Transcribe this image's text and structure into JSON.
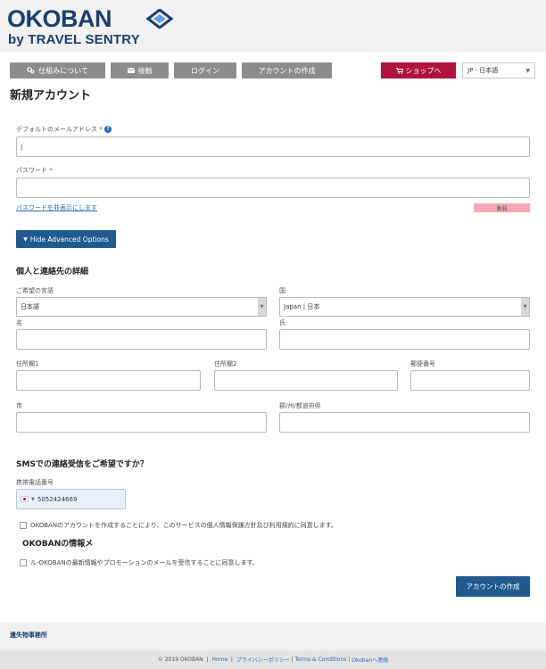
{
  "brand": {
    "logo_text": "OKOBAN",
    "logo_sub": "by TRAVEL SENTRY"
  },
  "nav": {
    "how_it_works": "仕組みについて",
    "contact": "接触",
    "login": "ログイン",
    "create_account": "アカウントの作成",
    "shop": "ショップへ",
    "language": "JP - 日本語"
  },
  "page": {
    "title": "新規アカウント"
  },
  "form": {
    "email_label": "デフォルトのメールアドレス *",
    "email_value": "|",
    "password_label": "パスワード *",
    "password_value": "",
    "hide_password_link": "パスワードを非表示にします",
    "strength_label": "脆弱",
    "advanced_button": "Hide Advanced Options",
    "personal_section_title": "個人と連絡先の詳細",
    "preferred_language_label": "ご希望の言語",
    "preferred_language_value": "日本語",
    "country_label": "国",
    "country_value": "Japan | 日本",
    "first_name_label": "名",
    "last_name_label": "氏",
    "address1_label": "住所欄1",
    "address2_label": "住所欄2",
    "postal_code_label": "郵便番号",
    "city_label": "市",
    "prefecture_label": "郡/州/都道府県",
    "sms_section_title": "SMSでの連絡受信をご希望ですか？",
    "mobile_label": "携帯電話番号",
    "mobile_value": "5052424669",
    "terms_checkbox": "OKOBANのアカウントを作成することにより、このサービスの個人情報保護方針及び利用規約に同意します。",
    "news_section_title": "OKOBANの情報メ",
    "promo_checkbox": "ル-OKOBANの最新情報やプロモーションのメールを受信することに同意します。",
    "submit_button": "アカウントの作成"
  },
  "lost_found_link": "遺失物事務所",
  "footer": {
    "copyright": "© 2019 OKOBAN",
    "home": "Home",
    "privacy": "プライバシーポリシー",
    "terms": "Terms & Conditions",
    "contact": "Okobanへ連絡"
  },
  "colors": {
    "brand_navy": "#1a3f6f",
    "shop_red": "#b0123e",
    "button_blue": "#1f5b8f",
    "nav_gray": "#8c8c8c",
    "strength_pink": "#f3a9b4"
  },
  "icons": {
    "how_it_works": "gears-icon",
    "contact": "envelope-icon",
    "shop": "cart-icon",
    "help": "help-icon",
    "advanced": "caret-down-icon"
  }
}
